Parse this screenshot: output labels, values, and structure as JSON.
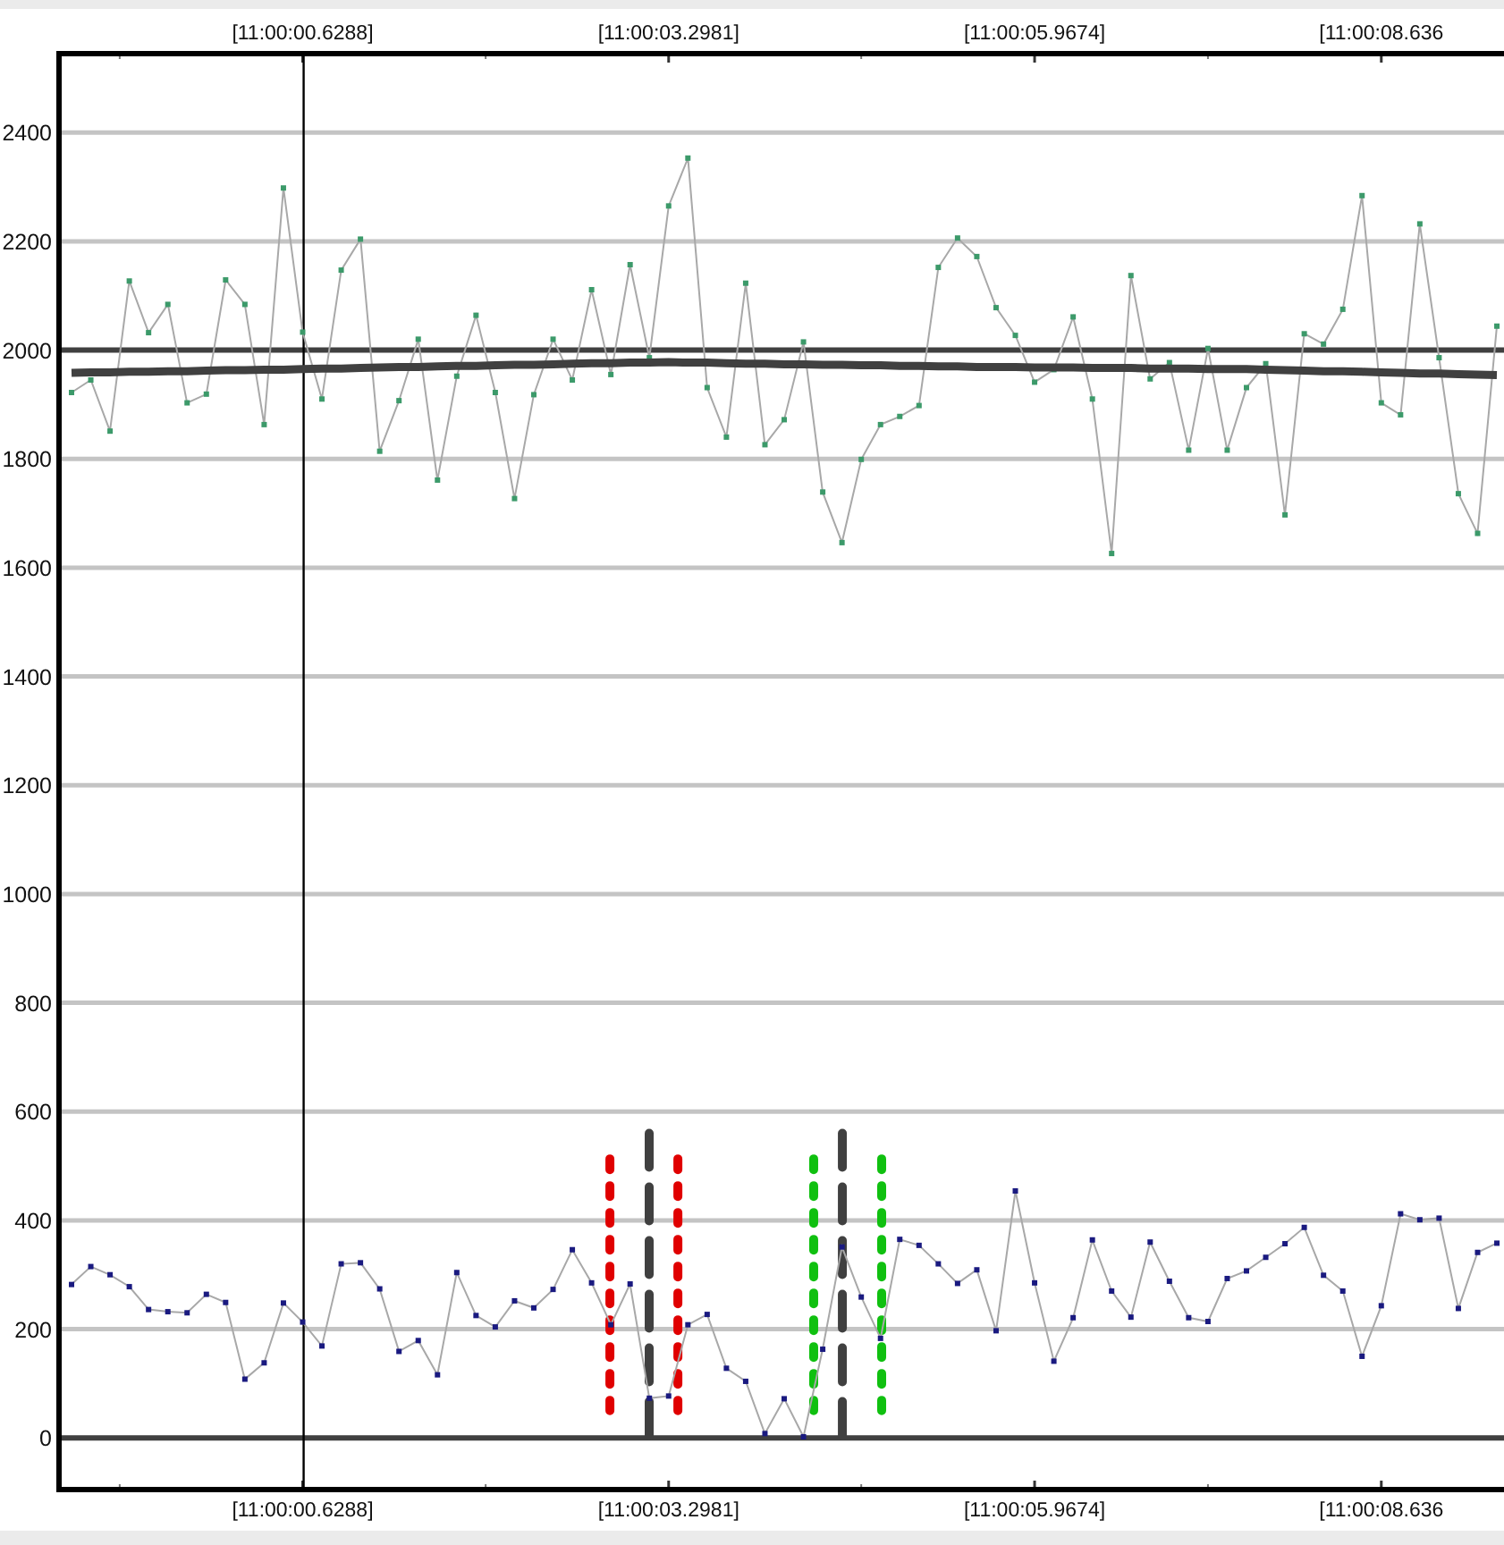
{
  "top_axis": {
    "labels": [
      "[11:00:00.6288]",
      "[11:00:03.2981]",
      "[11:00:05.9674]",
      "[11:00:08.636"
    ]
  },
  "chart_data": {
    "type": "line",
    "grid": true,
    "ylim": [
      -95,
      2545
    ],
    "yticks": [
      0,
      200,
      400,
      600,
      800,
      1000,
      1200,
      1400,
      1600,
      1800,
      2000,
      2200,
      2400
    ],
    "categories": [
      null,
      null,
      null,
      null,
      null,
      null,
      null,
      null,
      null,
      null,
      null,
      null,
      "[11:00:00.6288]",
      null,
      null,
      null,
      null,
      null,
      null,
      null,
      null,
      null,
      null,
      null,
      null,
      null,
      null,
      null,
      null,
      null,
      null,
      "[11:00:03.2981]",
      null,
      null,
      null,
      null,
      null,
      null,
      null,
      null,
      null,
      null,
      null,
      null,
      null,
      null,
      null,
      null,
      null,
      null,
      "[11:00:05.9674]",
      null,
      null,
      null,
      null,
      null,
      null,
      null,
      null,
      null,
      null,
      null,
      null,
      null,
      null,
      null,
      null,
      null,
      "[11:00:08.636",
      null,
      null,
      null,
      null,
      null,
      null
    ],
    "series": [
      {
        "color": "#3c9a6a",
        "marker": "square",
        "values": [
          1922,
          1945,
          1851,
          2127,
          2032,
          2084,
          1903,
          1919,
          2129,
          2084,
          1863,
          2298,
          2033,
          1910,
          2147,
          2204,
          1814,
          1907,
          2020,
          1761,
          1952,
          2064,
          1922,
          1727,
          1918,
          2020,
          1945,
          2111,
          1955,
          2157,
          1986,
          2265,
          2353,
          1931,
          1840,
          2123,
          1826,
          1872,
          2015,
          1739,
          1646,
          1799,
          1863,
          1878,
          1898,
          2152,
          2206,
          2172,
          2078,
          2027,
          1941,
          1964,
          2061,
          1910,
          1626,
          2137,
          1947,
          1977,
          1816,
          2003,
          1816,
          1931,
          1975,
          1697,
          2030,
          2011,
          2075,
          2284,
          1903,
          1881,
          2232,
          1986,
          1736,
          1663,
          2044
        ]
      },
      {
        "color": "#404040",
        "values": [
          1958,
          1959,
          1959,
          1960,
          1960,
          1961,
          1961,
          1962,
          1963,
          1963,
          1964,
          1964,
          1965,
          1966,
          1966,
          1967,
          1968,
          1969,
          1969,
          1970,
          1971,
          1971,
          1972,
          1973,
          1973,
          1974,
          1975,
          1976,
          1976,
          1977,
          1977,
          1978,
          1977,
          1977,
          1976,
          1975,
          1975,
          1974,
          1974,
          1973,
          1973,
          1972,
          1972,
          1971,
          1971,
          1970,
          1970,
          1969,
          1969,
          1969,
          1968,
          1968,
          1968,
          1967,
          1967,
          1967,
          1966,
          1966,
          1966,
          1965,
          1965,
          1965,
          1964,
          1963,
          1962,
          1961,
          1961,
          1960,
          1959,
          1958,
          1957,
          1957,
          1956,
          1955,
          1954
        ]
      },
      {
        "color": "#1a1a80",
        "marker": "square",
        "values": [
          282,
          315,
          300,
          278,
          236,
          232,
          230,
          264,
          249,
          108,
          138,
          248,
          213,
          169,
          320,
          322,
          274,
          159,
          179,
          116,
          304,
          225,
          204,
          252,
          239,
          273,
          346,
          285,
          208,
          283,
          73,
          77,
          208,
          227,
          128,
          104,
          8,
          72,
          2,
          163,
          351,
          259,
          183,
          365,
          354,
          320,
          284,
          309,
          197,
          454,
          285,
          141,
          221,
          364,
          270,
          222,
          360,
          288,
          221,
          214,
          293,
          307,
          332,
          357,
          387,
          299,
          270,
          150,
          243,
          412,
          401,
          404,
          238,
          341,
          358
        ]
      }
    ]
  }
}
